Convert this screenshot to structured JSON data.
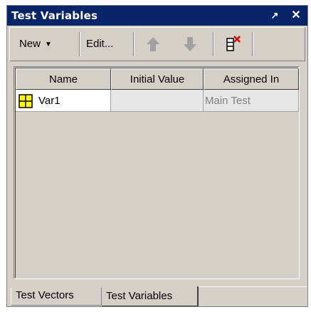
{
  "window": {
    "title": "Test Variables",
    "pin_glyph": "↗",
    "close_glyph": "✕"
  },
  "toolbar": {
    "new_label": "New",
    "edit_label": "Edit...",
    "icons": [
      "arrow-up-icon",
      "arrow-down-icon",
      "delete-variable-icon"
    ]
  },
  "grid": {
    "columns": [
      "Name",
      "Initial Value",
      "Assigned In"
    ],
    "rows": [
      {
        "name": "Var1",
        "initial_value": "",
        "assigned_in": "Main Test"
      }
    ]
  },
  "tabs": {
    "items": [
      "Test Vectors",
      "Test Variables"
    ],
    "active": "Test Variables"
  },
  "colors": {
    "titlebar": "#0a246a",
    "panel": "#d4d0c8",
    "arrow": "#a0a0a0",
    "variable_icon": "#ffff00",
    "delete_x": "#e00000"
  }
}
